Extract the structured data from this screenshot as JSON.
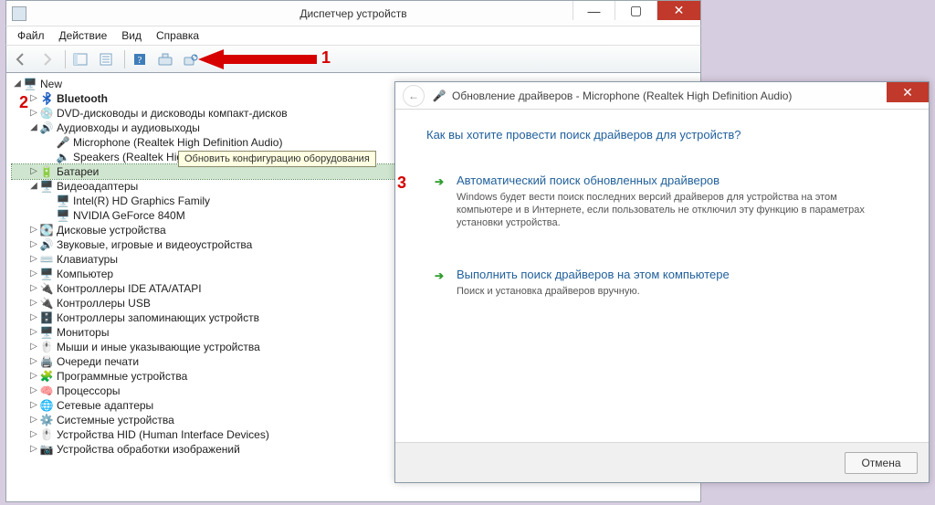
{
  "dm": {
    "title": "Диспетчер устройств",
    "menu": {
      "file": "Файл",
      "action": "Действие",
      "view": "Вид",
      "help": "Справка"
    },
    "tooltip": "Обновить конфигурацию оборудования",
    "root": "New",
    "nodes": {
      "bluetooth": "Bluetooth",
      "dvd": "DVD-дисководы и дисководы компакт-дисков",
      "audio": "Аудиовходы и аудиовыходы",
      "audio_mic": "Microphone (Realtek High Definition Audio)",
      "audio_spk": "Speakers (Realtek High Definition Audio)",
      "battery": "Батареи",
      "video": "Видеоадаптеры",
      "video_intel": "Intel(R) HD Graphics Family",
      "video_nvidia": "NVIDIA GeForce 840M",
      "disk": "Дисковые устройства",
      "sound": "Звуковые, игровые и видеоустройства",
      "keyboard": "Клавиатуры",
      "computer": "Компьютер",
      "ide": "Контроллеры IDE ATA/ATAPI",
      "usbctrl": "Контроллеры USB",
      "storage": "Контроллеры запоминающих устройств",
      "monitor": "Мониторы",
      "mouse": "Мыши и иные указывающие устройства",
      "printq": "Очереди печати",
      "software": "Программные устройства",
      "cpu": "Процессоры",
      "net": "Сетевые адаптеры",
      "sys": "Системные устройства",
      "hid": "Устройства HID (Human Interface Devices)",
      "imaging": "Устройства обработки изображений"
    }
  },
  "wizard": {
    "title": "Обновление драйверов - Microphone (Realtek High Definition Audio)",
    "question": "Как вы хотите провести поиск драйверов для устройств?",
    "opt1_h": "Автоматический поиск обновленных драйверов",
    "opt1_d": "Windows будет вести поиск последних версий драйверов для устройства на этом компьютере и в Интернете, если пользователь не отключил эту функцию в параметрах установки устройства.",
    "opt2_h": "Выполнить поиск драйверов на этом компьютере",
    "opt2_d": "Поиск и установка драйверов вручную.",
    "cancel": "Отмена"
  },
  "annotations": {
    "n1": "1",
    "n2": "2",
    "n3": "3"
  }
}
